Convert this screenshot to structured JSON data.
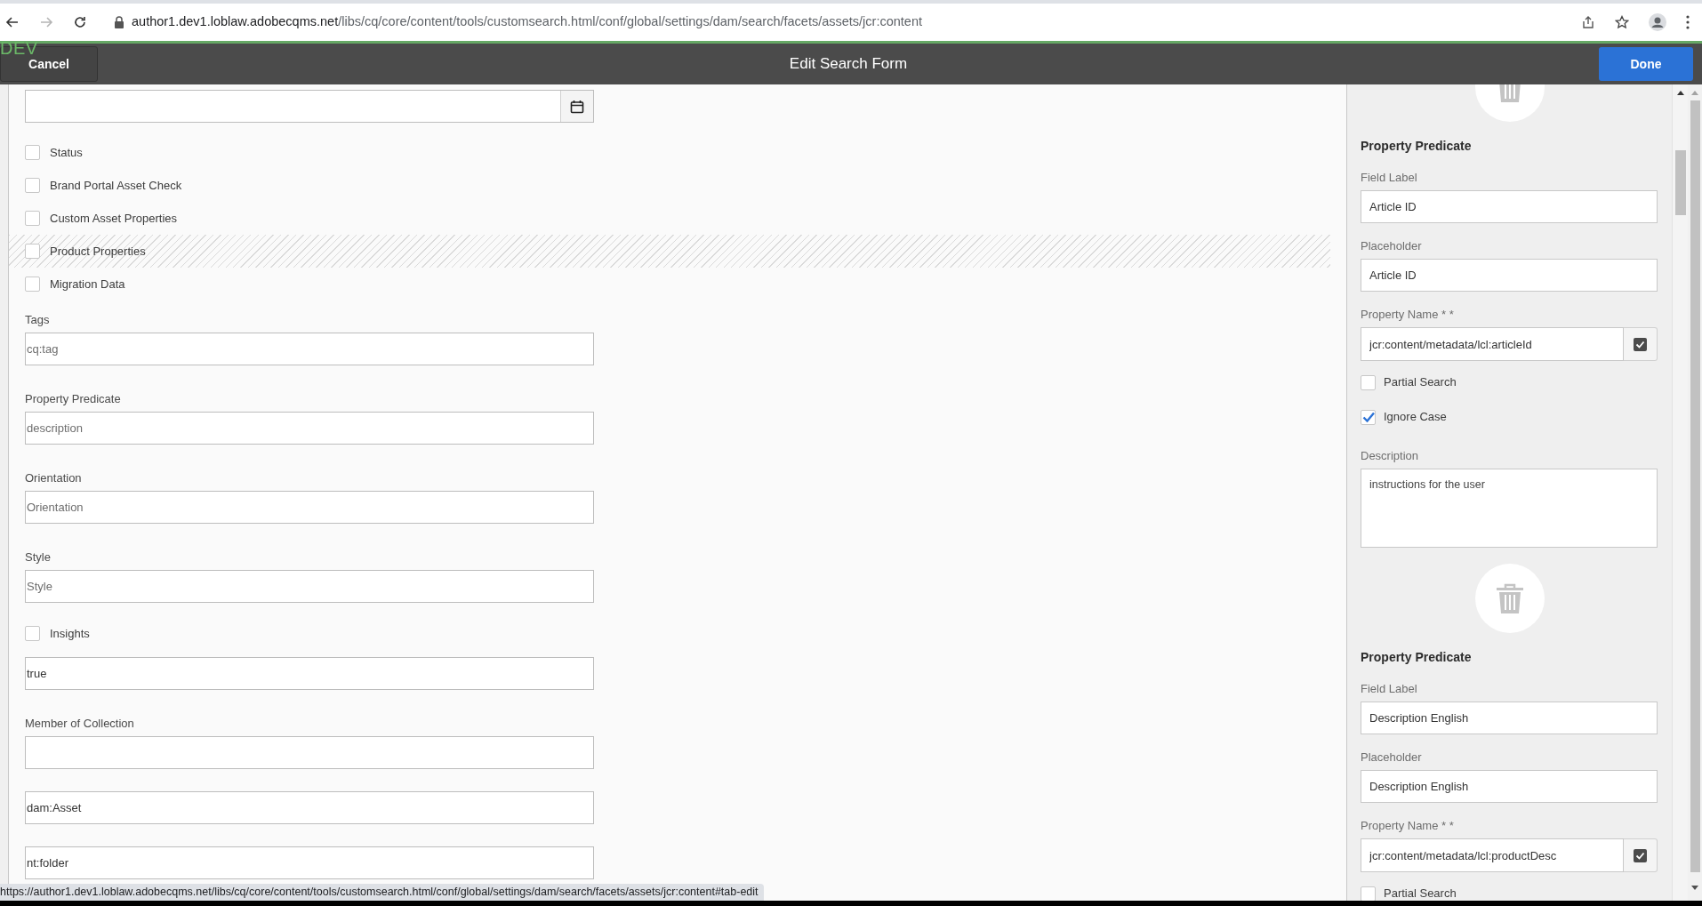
{
  "browser": {
    "url_host": "author1.dev1.loblaw.adobecqms.net",
    "url_path": "/libs/cq/core/content/tools/customsearch.html/conf/global/settings/dam/search/facets/assets/jcr:content",
    "forward_disabled": true
  },
  "header": {
    "environment": "DEV",
    "cancel": "Cancel",
    "title": "Edit Search Form",
    "done": "Done"
  },
  "form": [
    {
      "kind": "date"
    },
    {
      "kind": "checkbox",
      "label": "Status",
      "checked": false,
      "drop_target": false
    },
    {
      "kind": "checkbox",
      "label": "Brand Portal Asset Check",
      "checked": false,
      "drop_target": false
    },
    {
      "kind": "checkbox",
      "label": "Custom Asset Properties",
      "checked": false,
      "drop_target": false
    },
    {
      "kind": "checkbox",
      "label": "Product Properties",
      "checked": false,
      "drop_target": true
    },
    {
      "kind": "checkbox",
      "label": "Migration Data",
      "checked": false,
      "drop_target": false
    },
    {
      "kind": "field",
      "label": "Tags",
      "placeholder": "cq:tag"
    },
    {
      "kind": "field",
      "label": "Property Predicate",
      "placeholder": "description"
    },
    {
      "kind": "field",
      "label": "Orientation",
      "placeholder": "Orientation"
    },
    {
      "kind": "field",
      "label": "Style",
      "placeholder": "Style"
    },
    {
      "kind": "checkbox",
      "label": "Insights",
      "checked": false,
      "drop_target": false
    },
    {
      "kind": "field",
      "value": "true"
    },
    {
      "kind": "field",
      "label": "Member of Collection"
    },
    {
      "kind": "field",
      "value": "dam:Asset"
    },
    {
      "kind": "field",
      "value": "nt:folder"
    }
  ],
  "panel": [
    {
      "title": "Property Predicate",
      "fields": [
        {
          "kind": "text",
          "label": "Field Label",
          "value": "Article ID"
        },
        {
          "kind": "text",
          "label": "Placeholder",
          "value": "Article ID"
        },
        {
          "kind": "property",
          "label": "Property Name * *",
          "value": "jcr:content/metadata/lcl:articleId"
        },
        {
          "kind": "checkbox",
          "label": "Partial Search",
          "checked": false
        },
        {
          "kind": "checkbox",
          "label": "Ignore Case",
          "checked": true
        },
        {
          "kind": "textarea",
          "label": "Description",
          "value": "instructions for the user"
        }
      ]
    },
    {
      "title": "Property Predicate",
      "fields": [
        {
          "kind": "text",
          "label": "Field Label",
          "value": "Description English"
        },
        {
          "kind": "text",
          "label": "Placeholder",
          "value": "Description English"
        },
        {
          "kind": "property",
          "label": "Property Name * *",
          "value": "jcr:content/metadata/lcl:productDesc"
        },
        {
          "kind": "checkbox",
          "label": "Partial Search",
          "checked": false
        }
      ]
    }
  ],
  "status_url": "https://author1.dev1.loblaw.adobecqms.net/libs/cq/core/content/tools/customsearch.html/conf/global/settings/dam/search/facets/assets/jcr:content#tab-edit"
}
